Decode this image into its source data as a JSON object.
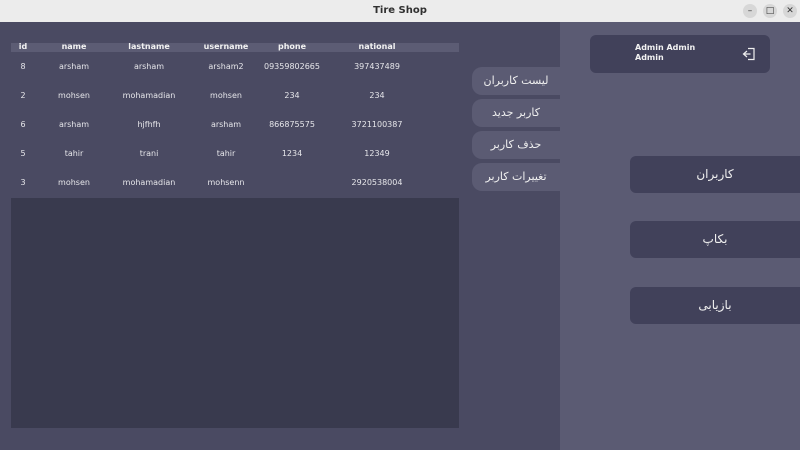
{
  "window": {
    "title": "Tire Shop"
  },
  "table": {
    "columns": [
      "id",
      "name",
      "lastname",
      "username",
      "phone",
      "national"
    ],
    "rows": [
      [
        "8",
        "arsham",
        "arsham",
        "arsham2",
        "09359802665",
        "397437489"
      ],
      [
        "2",
        "mohsen",
        "mohamadian",
        "mohsen",
        "234",
        "234"
      ],
      [
        "6",
        "arsham",
        "hjfhfh",
        "arsham",
        "866875575",
        "3721100387"
      ],
      [
        "5",
        "tahir",
        "trani",
        "tahir",
        "1234",
        "12349"
      ],
      [
        "3",
        "mohsen",
        "mohamadian",
        "mohsenn",
        "",
        "2920538004"
      ]
    ]
  },
  "tabs": [
    "لیست کاربران",
    "کاربر جدید",
    "حذف کاربر",
    "تغییرات کاربر"
  ],
  "user": {
    "name": "Admin Admin",
    "role": "Admin"
  },
  "sidebar": {
    "items": [
      "کاربران",
      "بکاپ",
      "بازیابی"
    ]
  },
  "icons": {
    "logout": "logout-icon",
    "minimize": "minimize-icon",
    "maximize": "maximize-icon",
    "close": "close-icon"
  }
}
